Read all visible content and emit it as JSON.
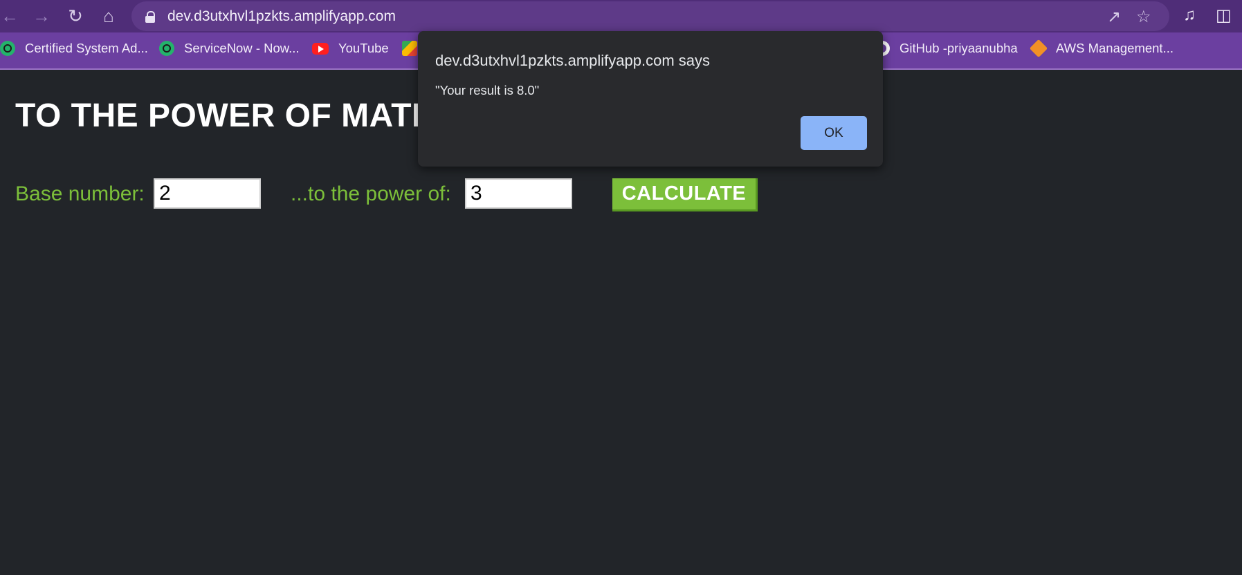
{
  "browser": {
    "url": "dev.d3utxhvl1pzkts.amplifyapp.com",
    "icons": {
      "back": "arrow-left-icon",
      "forward": "arrow-right-icon",
      "reload": "reload-icon",
      "home": "home-icon",
      "lock": "lock-icon",
      "share": "share-icon",
      "star": "star-icon",
      "media": "media-control-icon",
      "sidepanel": "side-panel-icon"
    },
    "bookmarks": [
      {
        "label": "Certified System Ad...",
        "icon": "servicenow-icon"
      },
      {
        "label": "ServiceNow - Now...",
        "icon": "servicenow-icon"
      },
      {
        "label": "YouTube",
        "icon": "youtube-icon"
      },
      {
        "label": "",
        "icon": "maps-icon"
      },
      {
        "label": "GitHub -priyaanubha",
        "icon": "github-icon"
      },
      {
        "label": "AWS Management...",
        "icon": "aws-icon"
      }
    ]
  },
  "page": {
    "title": "TO THE POWER OF MATH",
    "base_label": "Base number:",
    "base_value": "2",
    "power_label": "...to the power of:",
    "power_value": "3",
    "calculate_label": "CALCULATE"
  },
  "dialog": {
    "title": "dev.d3utxhvl1pzkts.amplifyapp.com says",
    "message": "\"Your result is 8.0\"",
    "ok_label": "OK"
  },
  "colors": {
    "toolbar": "#4f2d78",
    "bookmarks_bar": "#6b3fa0",
    "page_bg": "#222529",
    "accent_green": "#7cbf3a",
    "dialog_bg": "#292a2d",
    "ok_button": "#8ab4f8"
  }
}
